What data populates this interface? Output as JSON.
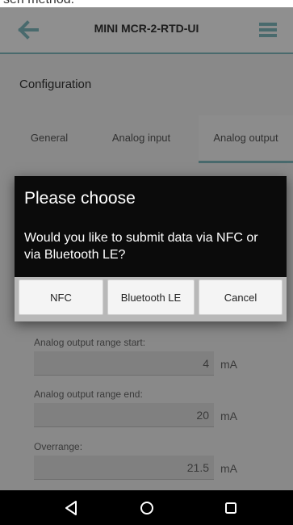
{
  "top_fragment": "sen method.",
  "app": {
    "title": "MINI MCR-2-RTD-UI",
    "back_icon": "arrow-left-icon",
    "menu_icon": "list-menu-icon",
    "accent_color": "#7fb7bc"
  },
  "section": {
    "title": "Configuration"
  },
  "tabs": [
    {
      "label": "General",
      "active": false
    },
    {
      "label": "Analog input",
      "active": false
    },
    {
      "label": "Analog output",
      "active": true
    }
  ],
  "form": {
    "fields": [
      {
        "label": "Analog output range start:",
        "value": "4",
        "unit": "mA"
      },
      {
        "label": "Analog output range end:",
        "value": "20",
        "unit": "mA"
      },
      {
        "label": "Overrange:",
        "value": "21.5",
        "unit": "mA"
      }
    ]
  },
  "dialog": {
    "title": "Please choose",
    "message": "Would you like to submit data via NFC or via Bluetooth LE?",
    "buttons": {
      "nfc": "NFC",
      "bluetooth": "Bluetooth LE",
      "cancel": "Cancel"
    }
  },
  "navbar": {
    "back_icon": "triangle-back-icon",
    "home_icon": "circle-home-icon",
    "recents_icon": "square-recents-icon"
  }
}
